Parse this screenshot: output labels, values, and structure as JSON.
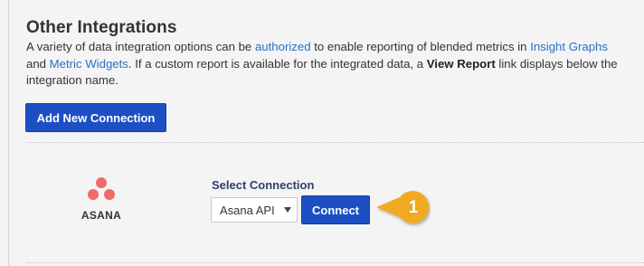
{
  "section": {
    "title": "Other Integrations",
    "description": {
      "p1": "A variety of data integration options can be ",
      "link_authorized": "authorized",
      "p2": " to enable reporting of blended metrics in ",
      "link_insight_graphs": "Insight Graphs",
      "p3": " and ",
      "link_metric_widgets": "Metric Widgets",
      "p4": ". If a custom report is available for the integrated data, a ",
      "bold_view_report": "View Report",
      "p5": " link displays below the integration name."
    },
    "add_button_label": "Add New Connection"
  },
  "integration": {
    "name": "ASANA",
    "logo_color": "#f06a6a",
    "select_label": "Select Connection",
    "select_value": "Asana API",
    "connect_label": "Connect"
  },
  "callout": {
    "number": "1",
    "color": "#f2a922"
  },
  "colors": {
    "primary_button": "#1d4fc4",
    "link": "#2a70c4",
    "background": "#f4f4f4"
  }
}
